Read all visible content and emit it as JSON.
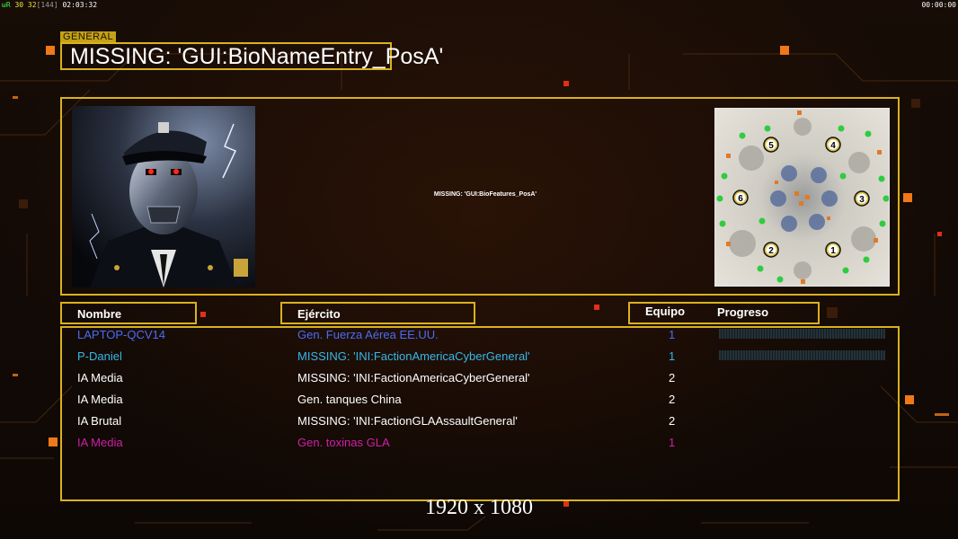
{
  "hud": {
    "fps_a": "ωR",
    "fps_b": "30 32",
    "fps_c": "[144]",
    "clock": "02:03:32",
    "timer": "00:00:00"
  },
  "colors": {
    "frame": "#d9b21c",
    "player_blue": "#4a6cf5",
    "player_cyan": "#35b8e8",
    "player_magenta": "#d21ea8",
    "player_white": "#ffffff"
  },
  "bio": {
    "tag": "GENERAL",
    "title": "MISSING: 'GUI:BioNameEntry_PosA'",
    "features": "MISSING: 'GUI:BioFeatures_PosA'",
    "portrait_icon": "cyber-general-portrait"
  },
  "map": {
    "icon": "minimap",
    "start_positions": [
      "1",
      "2",
      "3",
      "4",
      "5",
      "6"
    ]
  },
  "table": {
    "headers": {
      "name": "Nombre",
      "army": "Ejército",
      "team": "Equipo",
      "progress": "Progreso"
    },
    "rows": [
      {
        "name": "LAPTOP-QCV14",
        "army": "Gen. Fuerza Aérea EE.UU.",
        "team": "1",
        "color": "#4a6cf5",
        "progress": 0
      },
      {
        "name": "P-Daniel",
        "army": "MISSING: 'INI:FactionAmericaCyberGeneral'",
        "team": "1",
        "color": "#35b8e8",
        "progress": 0
      },
      {
        "name": "IA Media",
        "army": "MISSING: 'INI:FactionAmericaCyberGeneral'",
        "team": "2",
        "color": "#ffffff"
      },
      {
        "name": "IA Media",
        "army": "Gen. tanques China",
        "team": "2",
        "color": "#ffffff"
      },
      {
        "name": "IA Brutal",
        "army": "MISSING: 'INI:FactionGLAAssaultGeneral'",
        "team": "2",
        "color": "#ffffff"
      },
      {
        "name": "IA Media",
        "army": "Gen. toxinas GLA",
        "team": "1",
        "color": "#d21ea8"
      }
    ]
  },
  "resolution_label": "1920 x 1080"
}
